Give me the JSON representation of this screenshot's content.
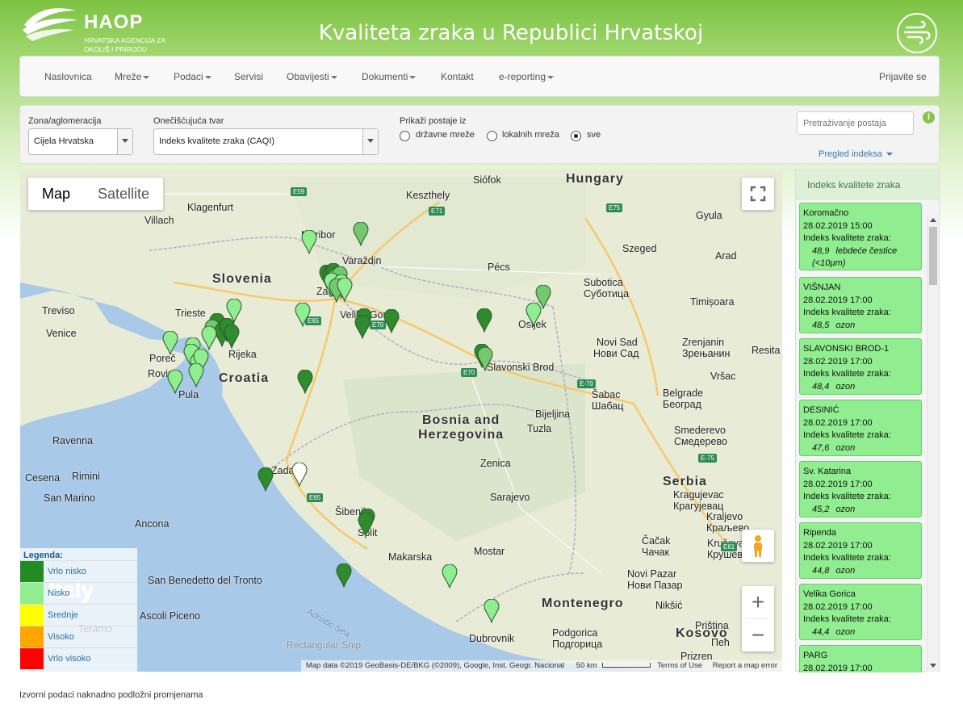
{
  "header": {
    "logo_text": "HAOP",
    "logo_subtitle": "HRVATSKA AGENCIJA ZA OKOLIŠ I PRIRODU",
    "title": "Kvaliteta zraka u Republici Hrvatskoj",
    "icon": "air-wind-icon"
  },
  "nav": {
    "items": [
      "Naslovnica",
      "Mreže",
      "Podaci",
      "Servisi",
      "Obavijesti",
      "Dokumenti",
      "Kontakt",
      "e-reporting"
    ],
    "login": "Prijavite se"
  },
  "filters": {
    "zone_label": "Zona/aglomeracija",
    "zone_value": "Cijela Hrvatska",
    "pollutant_label": "Onečišćujuća tvar",
    "pollutant_value": "Indeks kvalitete zraka (CAQI)",
    "show_label": "Prikaži postaje iz",
    "radio_options": [
      "državne mreže",
      "lokalnih mreža",
      "sve"
    ],
    "radio_selected": "sve",
    "search_placeholder": "Pretraživanje postaja",
    "index_overview": "Pregled indeksa"
  },
  "map": {
    "type_buttons": [
      "Map",
      "Satellite"
    ],
    "active_type": "Map",
    "countries": [
      "Hungary",
      "Slovenia",
      "Croatia",
      "Bosnia and",
      "Herzegovina",
      "Serbia",
      "Montenegro",
      "Kosovo",
      "Italy"
    ],
    "cities": [
      "Siófok",
      "Keszthely",
      "Gyula",
      "Klagenfurt",
      "Villach",
      "Maribor",
      "Varaždin",
      "Pécs",
      "Szeged",
      "Arad",
      "Subotica",
      "Суботица",
      "Timișoara",
      "Zagreb",
      "Velika Gorica",
      "Osijek",
      "Novi Sad",
      "Нови Сад",
      "Zrenjanin",
      "Зрењанин",
      "Resita",
      "Trieste",
      "Treviso",
      "Venice",
      "Poreč",
      "Rovinj",
      "Pula",
      "Rijeka",
      "Slavonski Brod",
      "Vršac",
      "Šabac",
      "Шабац",
      "Belgrade",
      "Београд",
      "Bijeljina",
      "Tuzla",
      "Ravenna",
      "Smederevo",
      "Смедерево",
      "Zenica",
      "Rimini",
      "San Marino",
      "Cesena",
      "Zadar",
      "Šibenik",
      "Split",
      "Sarajevo",
      "Kragujevac",
      "Крагујевац",
      "Kraljevo",
      "Краљево",
      "Kruševac",
      "Крушевац",
      "Čačak",
      "Чачак",
      "Ancona",
      "Mostar",
      "Makarska",
      "Novi Pazar",
      "Нови Пазар",
      "San Benedetto del Tronto",
      "Ascoli Piceno",
      "Teramo",
      "Nikšić",
      "Dubrovnik",
      "Podgorica",
      "Подгорица",
      "Prizren",
      "Priština",
      "Пећ",
      "Adriatic Sea"
    ],
    "roads": [
      "E59",
      "E71",
      "E75",
      "E65",
      "E70",
      "E70",
      "E-70",
      "E-75",
      "E65",
      "E61"
    ],
    "snip_label": "Rectangular Snip",
    "attribution": "Map data ©2019 GeoBasis-DE/BKG (©2009), Google, Inst. Geogr. Nacional",
    "scale": "50 km",
    "terms": "Terms of Use",
    "report": "Report a map error"
  },
  "legend": {
    "title": "Legenda:",
    "items": [
      {
        "label": "Vrlo nisko",
        "color": "#228b22"
      },
      {
        "label": "Nisko",
        "color": "#90ee90"
      },
      {
        "label": "Srednje",
        "color": "#ffff00"
      },
      {
        "label": "Visoko",
        "color": "#ffa500"
      },
      {
        "label": "Vrlo visoko",
        "color": "#ff0000"
      }
    ]
  },
  "panel": {
    "title": "Indeks kvalitete zraka",
    "index_label": "Indeks kvalitete zraka:",
    "stations": [
      {
        "name": "Koromačno",
        "time": "28.02.2019 15:00",
        "value": "48,9",
        "pollutant": "lebdeće čestice (<10µm)"
      },
      {
        "name": "VIŠNJAN",
        "time": "28.02.2019 17:00",
        "value": "48,5",
        "pollutant": "ozon"
      },
      {
        "name": "SLAVONSKI BROD-1",
        "time": "28.02.2019 17:00",
        "value": "48,4",
        "pollutant": "ozon"
      },
      {
        "name": "DESINIĆ",
        "time": "28.02.2019 17:00",
        "value": "47,6",
        "pollutant": "ozon"
      },
      {
        "name": "Sv. Katarina",
        "time": "28.02.2019 17:00",
        "value": "45,2",
        "pollutant": "ozon"
      },
      {
        "name": "Ripenda",
        "time": "28.02.2019 17:00",
        "value": "44,8",
        "pollutant": "ozon"
      },
      {
        "name": "Velika Gorica",
        "time": "28.02.2019 17:00",
        "value": "44,4",
        "pollutant": "ozon"
      },
      {
        "name": "PARG",
        "time": "28.02.2019 17:00",
        "value": "",
        "pollutant": ""
      }
    ]
  },
  "footer": "Izvorni podaci naknadno podložni promjenama"
}
